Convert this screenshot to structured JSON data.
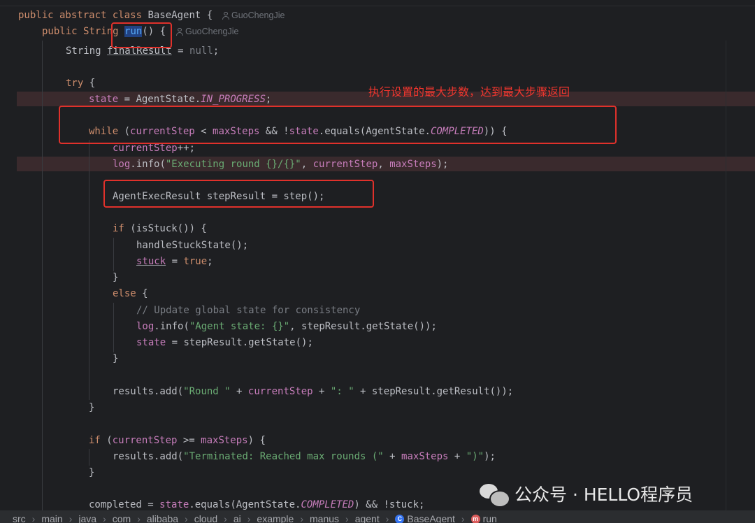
{
  "code": {
    "header1": [
      "public abstract class BaseAgent {"
    ],
    "author1": "GuoChengJie",
    "header2_pre": "public String ",
    "header2_method": "run",
    "header2_post": "() {",
    "author2": "GuoChengJie",
    "l_final_type": "String ",
    "l_final_var": "finalResult",
    "l_final_eq": " = ",
    "l_final_null": "null",
    "l_final_end": ";",
    "l_try": "try",
    "l_try_brace": " {",
    "l_state_var": "state",
    "l_state_mid": " = AgentState.",
    "l_state_const": "IN_PROGRESS",
    "l_state_end": ";",
    "l_while_kw": "while",
    "l_while_p1": " (",
    "l_while_cs": "currentStep",
    "l_while_lt": " < ",
    "l_while_ms": "maxSteps",
    "l_while_and": " && !",
    "l_while_state": "state",
    "l_while_eq": ".equals(AgentState.",
    "l_while_const": "COMPLETED",
    "l_while_end": ")) {",
    "l_inc_var": "currentStep",
    "l_inc_end": "++;",
    "l_log_var": "log",
    "l_log_mid": ".info(",
    "l_log_str": "\"Executing round {}/{}\"",
    "l_log_c": ", ",
    "l_log_cs": "currentStep",
    "l_log_c2": ", ",
    "l_log_ms": "maxSteps",
    "l_log_end": ");",
    "l_step": "AgentExecResult stepResult = step();",
    "l_if_kw": "if",
    "l_if_rest": " (isStuck()) {",
    "l_handle": "handleStuckState();",
    "l_stuck_var": "stuck",
    "l_stuck_eq": " = ",
    "l_stuck_true": "true",
    "l_stuck_end": ";",
    "l_close1": "}",
    "l_else_kw": "else",
    "l_else_brace": " {",
    "l_comment": "// Update global state for consistency",
    "l_log2_var": "log",
    "l_log2_mid": ".info(",
    "l_log2_str": "\"Agent state: {}\"",
    "l_log2_end": ", stepResult.getState());",
    "l_state2_var": "state",
    "l_state2_end": " = stepResult.getState();",
    "l_close2": "}",
    "l_results_pre": "results.add(",
    "l_results_s1": "\"Round \"",
    "l_results_p1": " + ",
    "l_results_cs": "currentStep",
    "l_results_p2": " + ",
    "l_results_s2": "\": \"",
    "l_results_end": " + stepResult.getResult());",
    "l_close3": "}",
    "l_if2_kw": "if",
    "l_if2_p": " (",
    "l_if2_cs": "currentStep",
    "l_if2_ge": " >= ",
    "l_if2_ms": "maxSteps",
    "l_if2_end": ") {",
    "l_term_pre": "results.add(",
    "l_term_s1": "\"Terminated: Reached max rounds (\"",
    "l_term_p": " + ",
    "l_term_ms": "maxSteps",
    "l_term_p2": " + ",
    "l_term_s2": "\")\"",
    "l_term_end": ");",
    "l_close4": "}",
    "l_completed_pre": "completed = ",
    "l_completed_state": "state",
    "l_completed_mid": ".equals(AgentState.",
    "l_completed_const": "COMPLETED",
    "l_completed_end": ") && !stuck;"
  },
  "annotation": "执行设置的最大步数，达到最大步骤返回",
  "breadcrumb": {
    "items": [
      "src",
      "main",
      "java",
      "com",
      "alibaba",
      "cloud",
      "ai",
      "example",
      "manus",
      "agent"
    ],
    "class_icon": "C",
    "class_name": "BaseAgent",
    "method_icon": "m",
    "method_name": "run"
  },
  "watermark": {
    "text": "公众号 · HELLO程序员",
    "icon": "wechat-logo"
  },
  "colors": {
    "background": "#1e1f22",
    "keyword": "#cf8e6d",
    "string": "#6aab73",
    "field": "#c77dbb",
    "comment": "#7a7e85",
    "annotation_red": "#e0312b"
  }
}
